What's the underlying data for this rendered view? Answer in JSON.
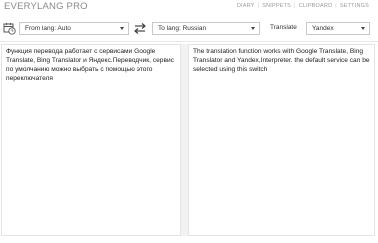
{
  "app": {
    "title": "EVERYLANG PRO"
  },
  "nav": {
    "items": [
      "DIARY",
      "SNIPPETS",
      "CLIPBOARD",
      "SETTINGS"
    ]
  },
  "toolbar": {
    "from_lang": "From lang: Auto",
    "to_lang": "To lang: Russian",
    "translate_label": "Translate",
    "engine": "Yandex"
  },
  "source": {
    "text": "Функция перевода работает с сервисами Google Translate, Bing Translator и Яндекс.Переводчик, сервис по умолчанию можно выбрать с помощью этого переключателя"
  },
  "target": {
    "text": "The translation function works with Google Translate, Bing Translator and Yandex,Interpreter. the default service can be selected using this switch"
  }
}
